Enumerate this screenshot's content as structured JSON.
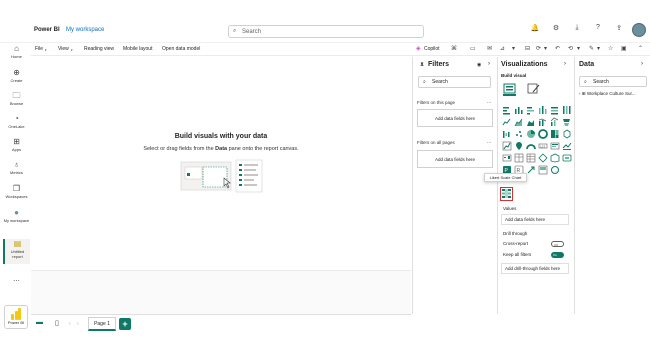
{
  "app": {
    "brand": "Power BI",
    "workspace": "My workspace",
    "search_placeholder": "Search"
  },
  "top_icons": [
    "bell-icon",
    "gear-icon",
    "download-icon",
    "help-icon",
    "share-icon"
  ],
  "nav": [
    {
      "label": "Home",
      "icon": "home-icon"
    },
    {
      "label": "Create",
      "icon": "plus-circle-icon"
    },
    {
      "label": "Browse",
      "icon": "folder-icon"
    },
    {
      "label": "OneLake",
      "icon": "onelake-icon"
    },
    {
      "label": "Apps",
      "icon": "apps-icon"
    },
    {
      "label": "Metrics",
      "icon": "trophy-icon"
    },
    {
      "label": "Workspaces",
      "icon": "workspaces-icon"
    },
    {
      "label": "My workspace",
      "icon": "workspace-avatar-icon"
    },
    {
      "label": "Untitled report",
      "icon": "report-icon"
    },
    {
      "label": "...",
      "icon": "more-icon"
    }
  ],
  "power_bi_tile": "Power BI",
  "ribbon": {
    "menus": [
      "File",
      "View",
      "Reading view",
      "Mobile layout",
      "Open data model"
    ],
    "copilot": "Copilot"
  },
  "canvas": {
    "title": "Build visuals with your data",
    "subtitle_before": "Select or drag fields from the ",
    "subtitle_bold": "Data",
    "subtitle_after": " pane onto the report canvas."
  },
  "pages": {
    "tab": "Page 1",
    "add": "+"
  },
  "filters": {
    "title": "Filters",
    "search": "Search",
    "on_page": "Filters on this page",
    "on_all": "Filters on all pages",
    "add_fields": "Add data fields here",
    "more": "..."
  },
  "viz": {
    "title": "Visualizations",
    "build": "Build visual",
    "tooltip": "Likert Scale Chart",
    "values": "Values",
    "add_fields": "Add data fields here",
    "drill": "Drill through",
    "cross_report": "Cross-report",
    "cross_state": "Off",
    "keep_filters": "Keep all filters",
    "keep_state": "On",
    "add_drill": "Add drill-through fields here"
  },
  "data": {
    "title": "Data",
    "search": "Search",
    "table": "Workplace Culture Sur..."
  },
  "colors": {
    "accent": "#117865",
    "brand_yellow": "#f2c811",
    "link_blue": "#0f6cbd",
    "highlight_red": "#d13438"
  }
}
